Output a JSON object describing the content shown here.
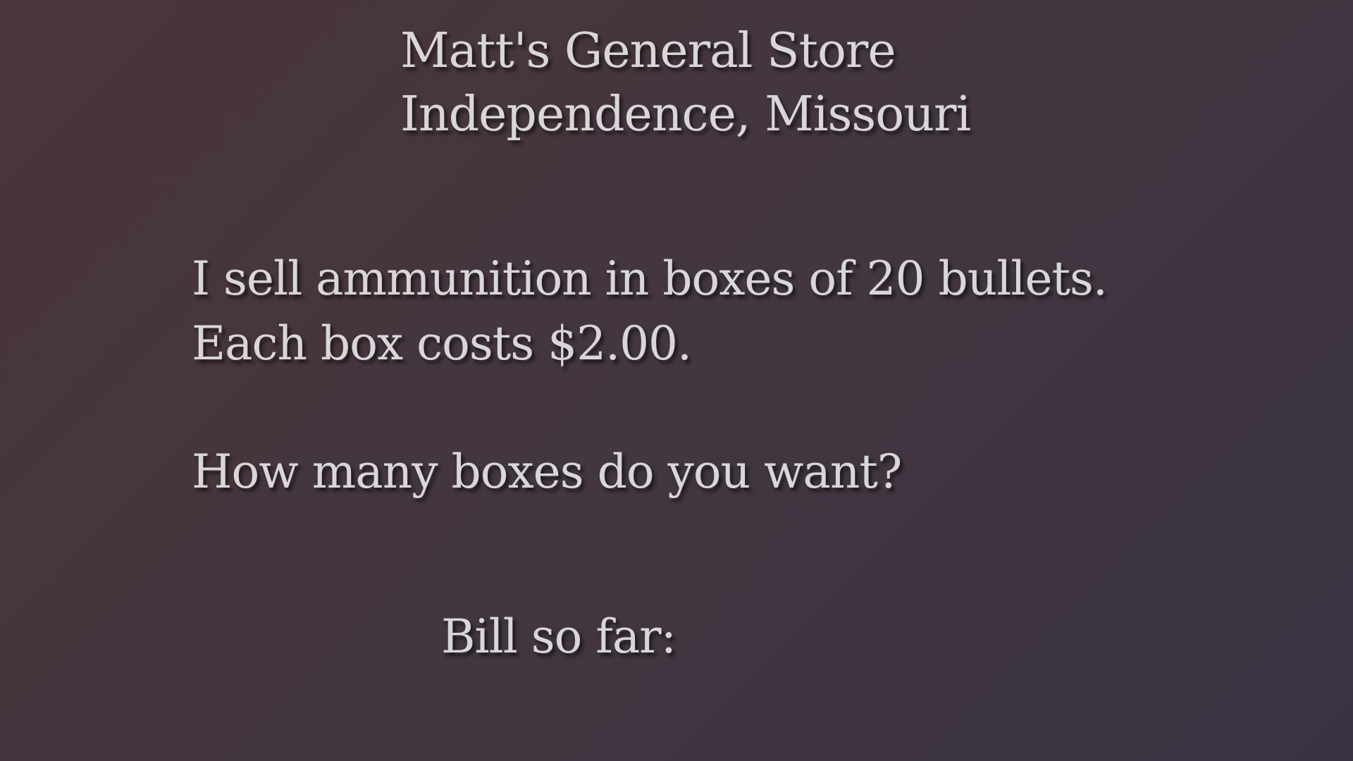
{
  "header": {
    "store_name": "Matt's General Store",
    "location": "Independence, Missouri"
  },
  "dialog": {
    "line1": "I sell ammunition in boxes of 20 bullets.",
    "line2": "Each box costs $2.00.",
    "question": "How many boxes do you want?"
  },
  "bill": {
    "label": "Bill so far:"
  }
}
